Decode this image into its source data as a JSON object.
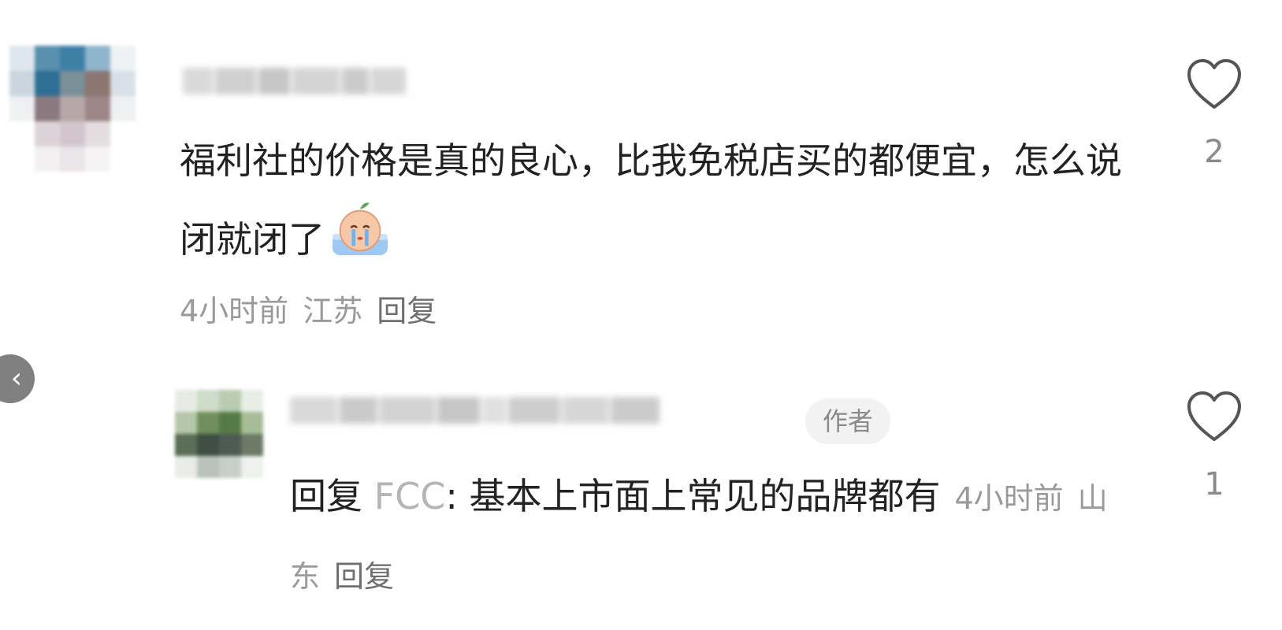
{
  "comments": [
    {
      "username": "",
      "text": "福利社的价格是真的良心，比我免税店买的都便宜，怎么说闭就闭了",
      "emoji": "crying-emoji",
      "time": "4小时前",
      "location": "江苏",
      "reply_label": "回复",
      "likes": "2",
      "avatar_colors": [
        "#dfe7ee",
        "#5a8fae",
        "#3e7fa6",
        "#8fb5cc",
        "#eef2f5",
        "#c9d6df",
        "#2f6f95",
        "#7a8f98",
        "#8c7770",
        "#d7e0e6",
        "#eef0f2",
        "#8a7a80",
        "#b7a7a8",
        "#9d8688",
        "#eef0f2",
        "#ffffff",
        "#dcd3d8",
        "#d2c6cc",
        "#e4dde0",
        "#ffffff",
        "#ffffff",
        "#f3f0f2",
        "#e9e5e8",
        "#f5f3f4",
        "#ffffff"
      ]
    },
    {
      "username": "",
      "author_badge": "作者",
      "reply_prefix": "回复",
      "reply_target": "FCC",
      "text": ": 基本上市面上常见的品牌都有",
      "time": "4小时前",
      "location": "山东",
      "reply_label": "回复",
      "likes": "1",
      "avatar_colors": [
        "#e6ece4",
        "#cfdcc9",
        "#b9ccb1",
        "#e8eee6",
        "#b5c6a8",
        "#6f8f5c",
        "#567a47",
        "#a7bd98",
        "#5a6f55",
        "#3f4f44",
        "#4d5b55",
        "#6c7a66",
        "#e9ece8",
        "#b9c2bb",
        "#c7cfc9",
        "#eef1ee"
      ]
    }
  ],
  "icons": {
    "like": "heart-outline-icon",
    "back": "chevron-left-icon"
  },
  "back_glyph": "‹"
}
